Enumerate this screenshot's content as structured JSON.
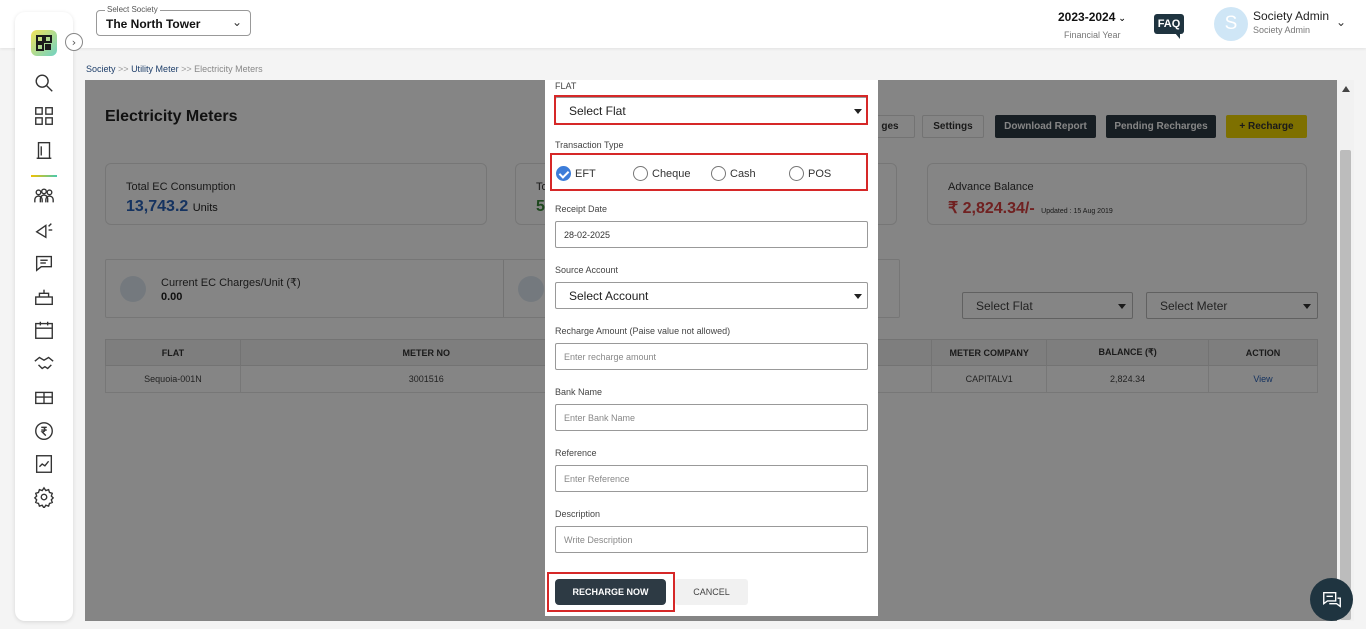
{
  "header": {
    "society_label": "Select Society",
    "society_value": "The North Tower",
    "financial_year": "2023-2024",
    "financial_year_label": "Financial Year",
    "faq": "FAQ",
    "avatar_letter": "S",
    "user_name": "Society Admin",
    "user_role": "Society Admin"
  },
  "sidebar": {
    "logo": "品",
    "icons": [
      "search-icon",
      "dashboard-icon",
      "building-icon",
      "community-icon",
      "announcement-icon",
      "chat-icon",
      "facility-icon",
      "calendar-icon",
      "handshake-icon",
      "parcel-icon",
      "rupee-icon",
      "report-icon",
      "settings-icon"
    ]
  },
  "breadcrumb": {
    "society": "Society",
    "sep": ">>",
    "utility": "Utility Meter",
    "current": "Electricity Meters"
  },
  "page": {
    "title": "Electricity Meters",
    "buttons": {
      "charges": "ges",
      "settings": "Settings",
      "download": "Download Report",
      "pending": "Pending Recharges",
      "recharge": "+ Recharge"
    },
    "cards": {
      "consumption_title": "Total EC Consumption",
      "consumption_value": "13,743.2",
      "consumption_unit": "Units",
      "second_title": "To",
      "second_value": "5",
      "advance_title": "Advance Balance",
      "advance_value": "₹ 2,824.34/-",
      "advance_updated": "Updated : 15 Aug 2019",
      "ec_charges_title": "Current EC Charges/Unit (₹)",
      "ec_charges_value": "0.00"
    },
    "filters": {
      "flat": "Select Flat",
      "meter": "Select Meter"
    },
    "table": {
      "headers": [
        "FLAT",
        "METER NO",
        "METER COMPANY",
        "BALANCE (₹)",
        "ACTION"
      ],
      "rows": [
        {
          "flat": "Sequoia-001N",
          "meter_no": "3001516",
          "company": "CAPITALV1",
          "balance": "2,824.34",
          "action": "View"
        }
      ]
    }
  },
  "modal": {
    "flat_label": "FLAT",
    "flat_value": "Select Flat",
    "txn_label": "Transaction Type",
    "txn_options": [
      "EFT",
      "Cheque",
      "Cash",
      "POS"
    ],
    "txn_selected": "EFT",
    "receipt_label": "Receipt Date",
    "receipt_value": "28-02-2025",
    "source_label": "Source Account",
    "source_value": "Select Account",
    "amount_label": "Recharge Amount (Paise value not allowed)",
    "amount_placeholder": "Enter recharge amount",
    "bank_label": "Bank Name",
    "bank_placeholder": "Enter Bank Name",
    "ref_label": "Reference",
    "ref_placeholder": "Enter Reference",
    "desc_label": "Description",
    "desc_placeholder": "Write Description",
    "submit": "RECHARGE NOW",
    "cancel": "CANCEL"
  },
  "colors": {
    "highlight": "#d62828",
    "primary_dark": "#2d3a44",
    "accent_yellow": "#f2d600",
    "advance_red": "#d64040",
    "consumption_blue": "#2a62b8"
  }
}
